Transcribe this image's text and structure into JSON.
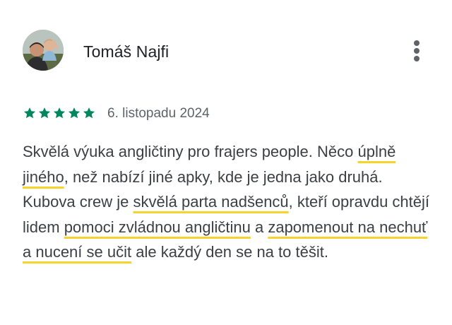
{
  "review": {
    "reviewer_name": "Tomáš Najfi",
    "rating": 5,
    "rating_max": 5,
    "date": "6. listopadu 2024",
    "text_parts": [
      {
        "text": "Skvělá výuka angličtiny pro frajers people. Něco ",
        "highlight": false
      },
      {
        "text": "úplně jiného",
        "highlight": true
      },
      {
        "text": ", než nabízí jiné apky, kde je jedna jako druhá. Kubova crew je ",
        "highlight": false
      },
      {
        "text": "skvělá parta nadšenců",
        "highlight": true
      },
      {
        "text": ", kteří opravdu chtějí lidem ",
        "highlight": false
      },
      {
        "text": "pomoci zvládnou angličtinu",
        "highlight": true
      },
      {
        "text": " a ",
        "highlight": false
      },
      {
        "text": "zapomenout na nechuť a nucení se učit",
        "highlight": true
      },
      {
        "text": " ale každý den se na to těšit.",
        "highlight": false
      }
    ]
  },
  "colors": {
    "star": "#01875f",
    "highlight_underline": "#f6d32d",
    "name_text": "#202124",
    "date_text": "#5f6368",
    "body_text": "#3c4043"
  },
  "icons": {
    "more": "more-vert-icon",
    "star": "star-icon"
  }
}
